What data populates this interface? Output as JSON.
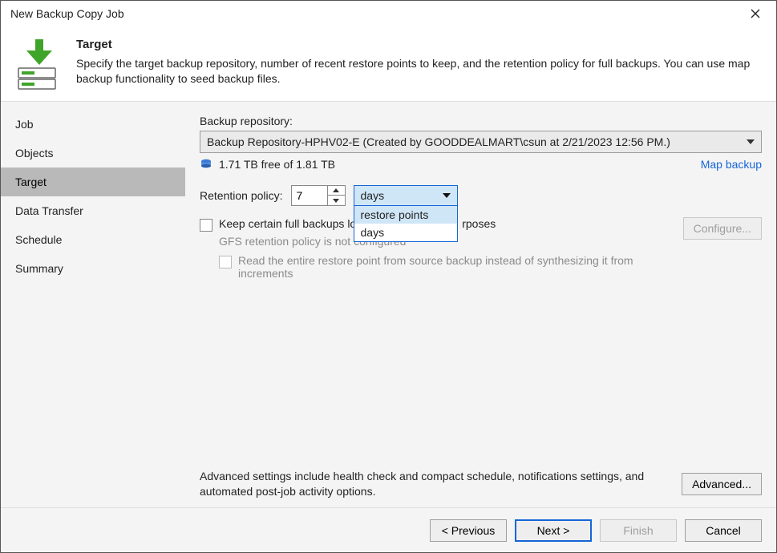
{
  "window": {
    "title": "New Backup Copy Job"
  },
  "header": {
    "title": "Target",
    "description": "Specify the target backup repository, number of recent restore points to keep, and the retention policy for full backups. You can use map backup functionality to seed backup files."
  },
  "sidebar": {
    "items": [
      {
        "label": "Job"
      },
      {
        "label": "Objects"
      },
      {
        "label": "Target"
      },
      {
        "label": "Data Transfer"
      },
      {
        "label": "Schedule"
      },
      {
        "label": "Summary"
      }
    ],
    "active_index": 2
  },
  "main": {
    "repo_label": "Backup repository:",
    "repo_value": "Backup Repository-HPHV02-E (Created by GOODDEALMART\\csun at 2/21/2023 12:56 PM.)",
    "free_space": "1.71 TB free of 1.81 TB",
    "map_backup": "Map backup",
    "retention_label": "Retention policy:",
    "retention_value": "7",
    "retention_unit_selected": "days",
    "retention_unit_options": [
      "restore points",
      "days"
    ],
    "gfs_checkbox_label_partial_left": "Keep certain full backups lo",
    "gfs_checkbox_label_partial_right": "rposes",
    "gfs_status": "GFS retention policy is not configured",
    "read_entire_label": "Read the entire restore point from source backup instead of synthesizing it from increments",
    "configure_btn": "Configure...",
    "advanced_text": "Advanced settings include health check and compact schedule, notifications settings, and automated post-job activity options.",
    "advanced_btn": "Advanced..."
  },
  "footer": {
    "previous": "< Previous",
    "next": "Next >",
    "finish": "Finish",
    "cancel": "Cancel"
  }
}
